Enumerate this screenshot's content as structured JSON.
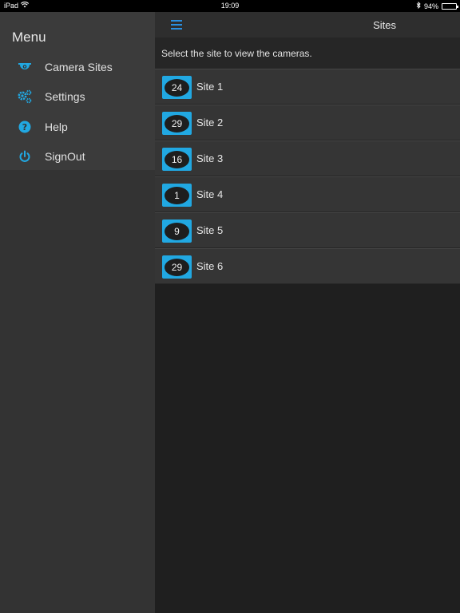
{
  "status": {
    "device": "iPad",
    "time": "19:09",
    "battery": "94%",
    "battery_level": 0.94
  },
  "menu": {
    "title": "Menu",
    "items": [
      {
        "label": "Camera Sites",
        "icon": "camera-icon"
      },
      {
        "label": "Settings",
        "icon": "gears-icon"
      },
      {
        "label": "Help",
        "icon": "help-icon"
      },
      {
        "label": "SignOut",
        "icon": "power-icon"
      }
    ]
  },
  "header": {
    "title": "Sites"
  },
  "instruction": "Select the site to view the cameras.",
  "sites": [
    {
      "name": "Site 1",
      "count": "24"
    },
    {
      "name": "Site 2",
      "count": "29"
    },
    {
      "name": "Site 3",
      "count": "16"
    },
    {
      "name": "Site 4",
      "count": "1"
    },
    {
      "name": "Site 5",
      "count": "9"
    },
    {
      "name": "Site 6",
      "count": "29"
    }
  ],
  "colors": {
    "accent": "#21a8e2",
    "menu_icon": "#2a8fe0"
  }
}
